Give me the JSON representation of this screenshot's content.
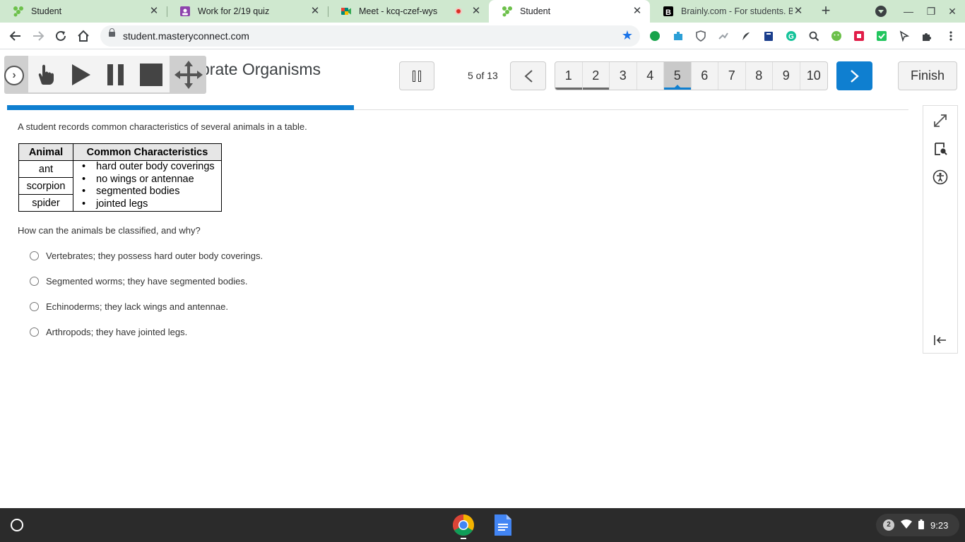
{
  "browser": {
    "tabs": [
      {
        "title": "Student",
        "icon": "masteryconnect-icon",
        "active": false
      },
      {
        "title": "Work for 2/19 quiz",
        "icon": "classroom-icon",
        "active": false
      },
      {
        "title": "Meet - kcq-czef-wys",
        "icon": "meet-icon",
        "active": false,
        "recording": true
      },
      {
        "title": "Student",
        "icon": "masteryconnect-icon",
        "active": true
      },
      {
        "title": "Brainly.com - For students. By",
        "icon": "brainly-icon",
        "active": false
      }
    ],
    "new_tab": "+",
    "url": "student.masteryconnect.com"
  },
  "quiz": {
    "title": "brate Organisms",
    "progress_text": "5 of 13",
    "progress_fraction": 0.385,
    "question_numbers": [
      "1",
      "2",
      "3",
      "4",
      "5",
      "6",
      "7",
      "8",
      "9",
      "10"
    ],
    "current_question": "5",
    "answered_questions": [
      "1",
      "2"
    ],
    "finish_label": "Finish"
  },
  "question": {
    "stem": "A student records common characteristics of several animals in a table.",
    "table": {
      "headers": [
        "Animal",
        "Common Characteristics"
      ],
      "animals": [
        "ant",
        "scorpion",
        "spider"
      ],
      "characteristics": [
        "hard outer body coverings",
        "no wings or antennae",
        "segmented bodies",
        "jointed legs"
      ]
    },
    "prompt": "How can the animals be classified, and why?",
    "options": [
      "Vertebrates; they possess hard outer body coverings.",
      "Segmented worms; they have segmented bodies.",
      "Echinoderms; they lack wings and antennae.",
      "Arthropods; they have jointed legs."
    ]
  },
  "shelf": {
    "notification_count": "2",
    "time": "9:23"
  },
  "colors": {
    "accent": "#0f7fd0",
    "tabstrip": "#cfe8cf"
  }
}
